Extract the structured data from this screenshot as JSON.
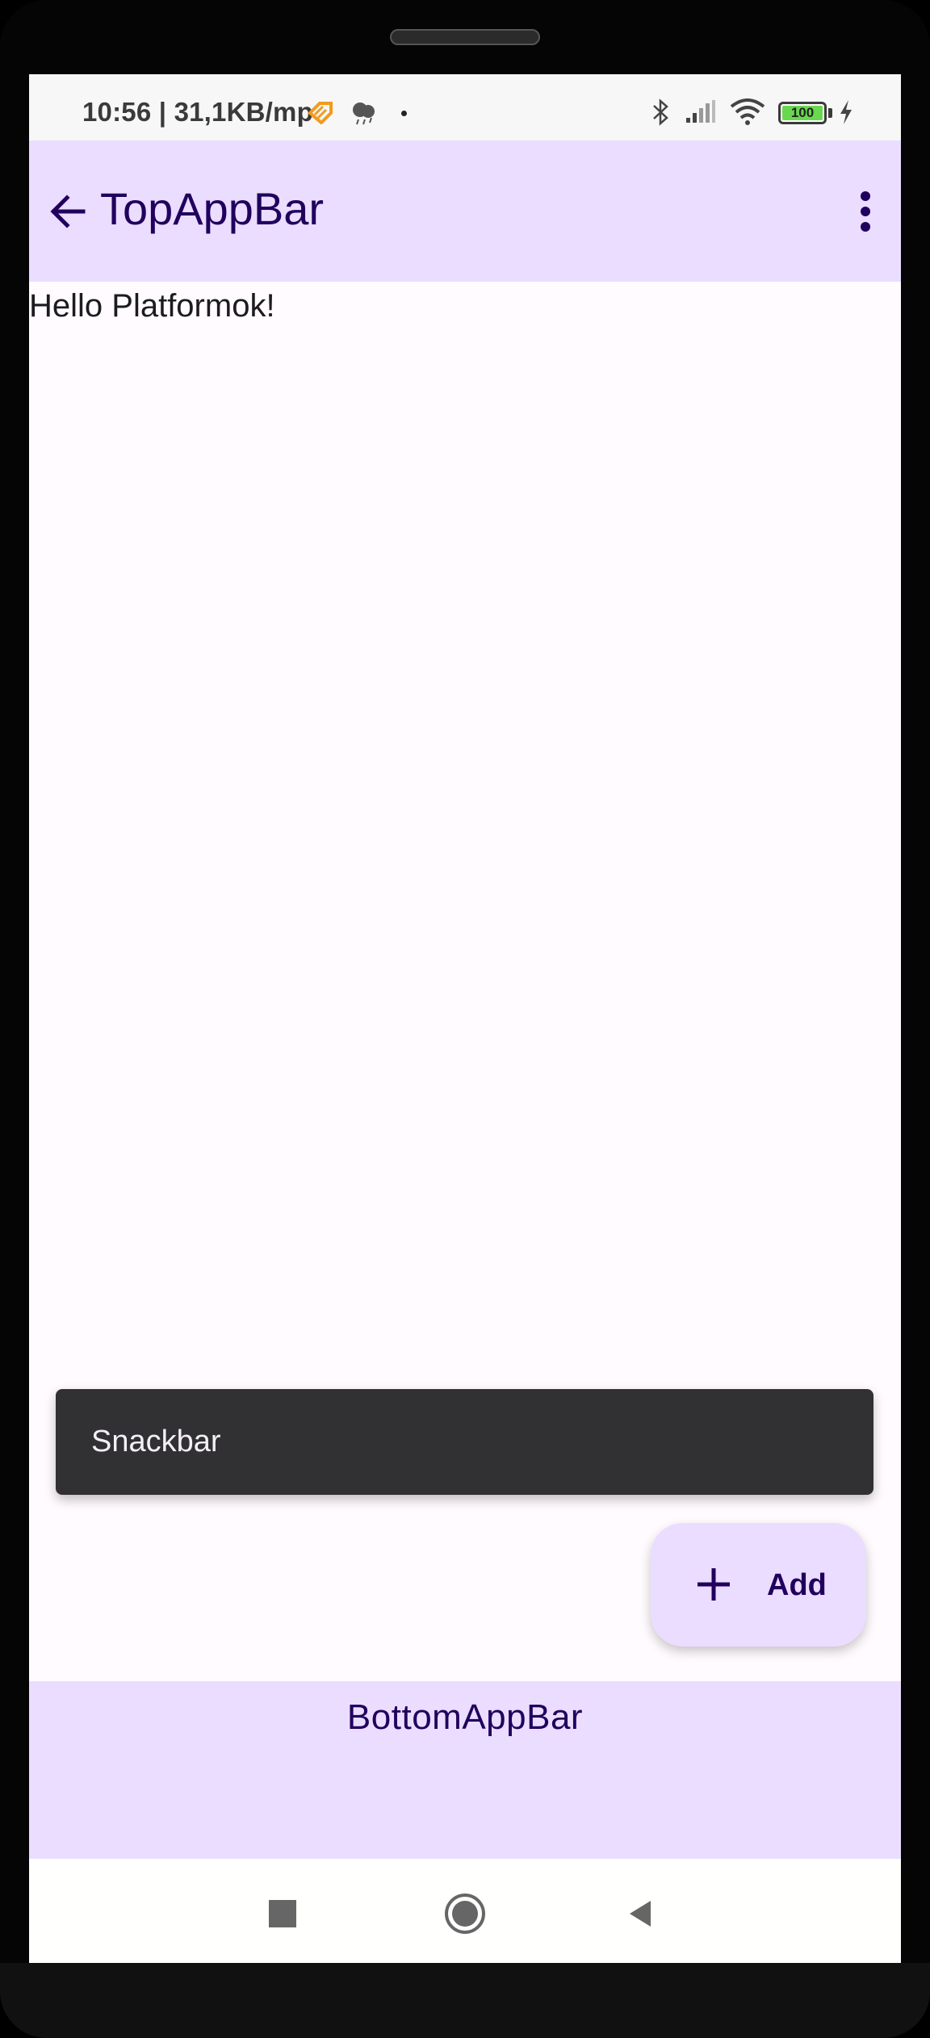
{
  "status_bar": {
    "text": "10:56 | 31,1KB/mp",
    "battery_level": "100",
    "icons": [
      "heart-tag-icon",
      "weather-icon",
      "dot-icon",
      "bluetooth-icon",
      "signal-icon",
      "wifi-icon",
      "battery-icon",
      "charging-icon"
    ]
  },
  "top_app_bar": {
    "title": "TopAppBar",
    "navigation_icon": "arrow-back-icon",
    "action_icon": "more-vert-icon"
  },
  "content": {
    "greeting": "Hello Platformok!"
  },
  "snackbar": {
    "message": "Snackbar"
  },
  "fab": {
    "label": "Add",
    "icon": "plus-icon"
  },
  "bottom_app_bar": {
    "title": "BottomAppBar"
  },
  "system_nav": {
    "items": [
      "recents-icon",
      "home-icon",
      "back-icon"
    ]
  },
  "colors": {
    "bar_background": "#eaddff",
    "on_bar": "#21005d",
    "surface": "#fffbfe",
    "snackbar": "#313033"
  }
}
